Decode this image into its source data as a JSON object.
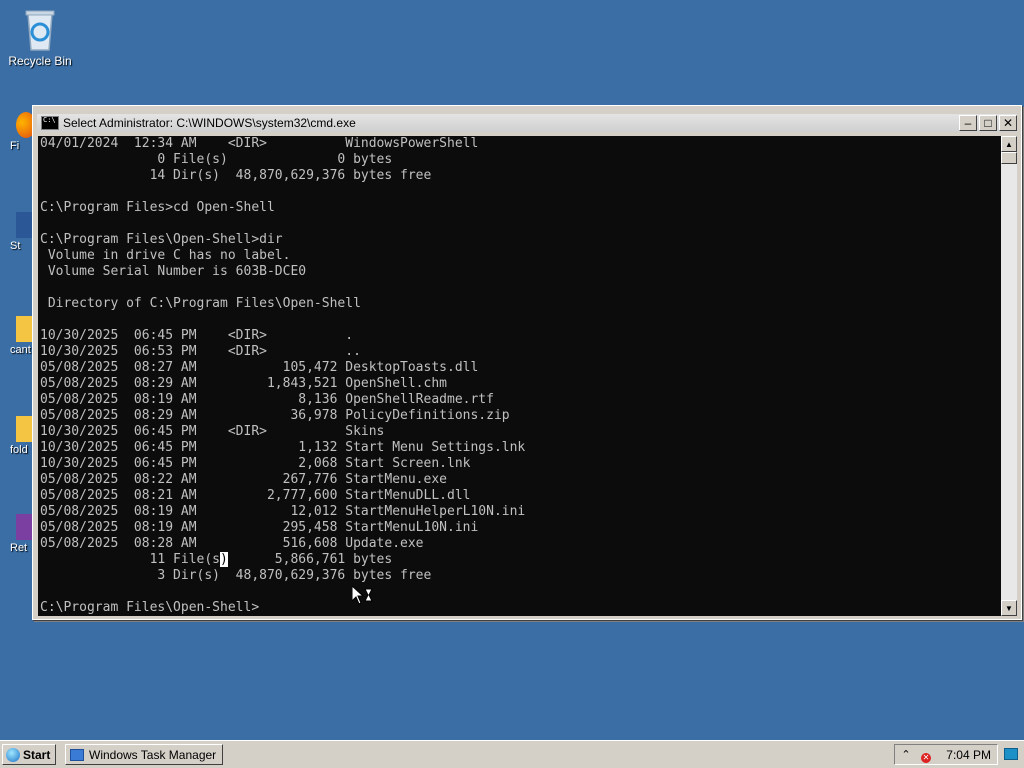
{
  "desktop": {
    "recycle_bin_label": "Recycle Bin",
    "partial_labels": [
      "Fi",
      "St",
      "cant",
      "fold",
      "Ret"
    ]
  },
  "window": {
    "title": "Select Administrator: C:\\WINDOWS\\system32\\cmd.exe",
    "minimize": "–",
    "maximize": "□",
    "close": "✕"
  },
  "console": {
    "lines": [
      "04/01/2024  12:34 AM    <DIR>          WindowsPowerShell",
      "               0 File(s)              0 bytes",
      "              14 Dir(s)  48,870,629,376 bytes free",
      "",
      "C:\\Program Files>cd Open-Shell",
      "",
      "C:\\Program Files\\Open-Shell>dir",
      " Volume in drive C has no label.",
      " Volume Serial Number is 603B-DCE0",
      "",
      " Directory of C:\\Program Files\\Open-Shell",
      "",
      "10/30/2025  06:45 PM    <DIR>          .",
      "10/30/2025  06:53 PM    <DIR>          ..",
      "05/08/2025  08:27 AM           105,472 DesktopToasts.dll",
      "05/08/2025  08:29 AM         1,843,521 OpenShell.chm",
      "05/08/2025  08:19 AM             8,136 OpenShellReadme.rtf",
      "05/08/2025  08:29 AM            36,978 PolicyDefinitions.zip",
      "10/30/2025  06:45 PM    <DIR>          Skins",
      "10/30/2025  06:45 PM             1,132 Start Menu Settings.lnk",
      "10/30/2025  06:45 PM             2,068 Start Screen.lnk",
      "05/08/2025  08:22 AM           267,776 StartMenu.exe",
      "05/08/2025  08:21 AM         2,777,600 StartMenuDLL.dll",
      "05/08/2025  08:19 AM            12,012 StartMenuHelperL10N.ini",
      "05/08/2025  08:19 AM           295,458 StartMenuL10N.ini",
      "05/08/2025  08:28 AM           516,608 Update.exe"
    ],
    "summary_prefix": "              11 File(s",
    "summary_selected": ")",
    "summary_suffix": "      5,866,761 bytes",
    "dirs_line": "               3 Dir(s)  48,870,629,376 bytes free",
    "prompt": "C:\\Program Files\\Open-Shell>"
  },
  "taskbar": {
    "start_label": "Start",
    "task_label": "Windows Task Manager",
    "clock": "7:04 PM",
    "tray_up": "⌃",
    "tray_net": "✕"
  }
}
